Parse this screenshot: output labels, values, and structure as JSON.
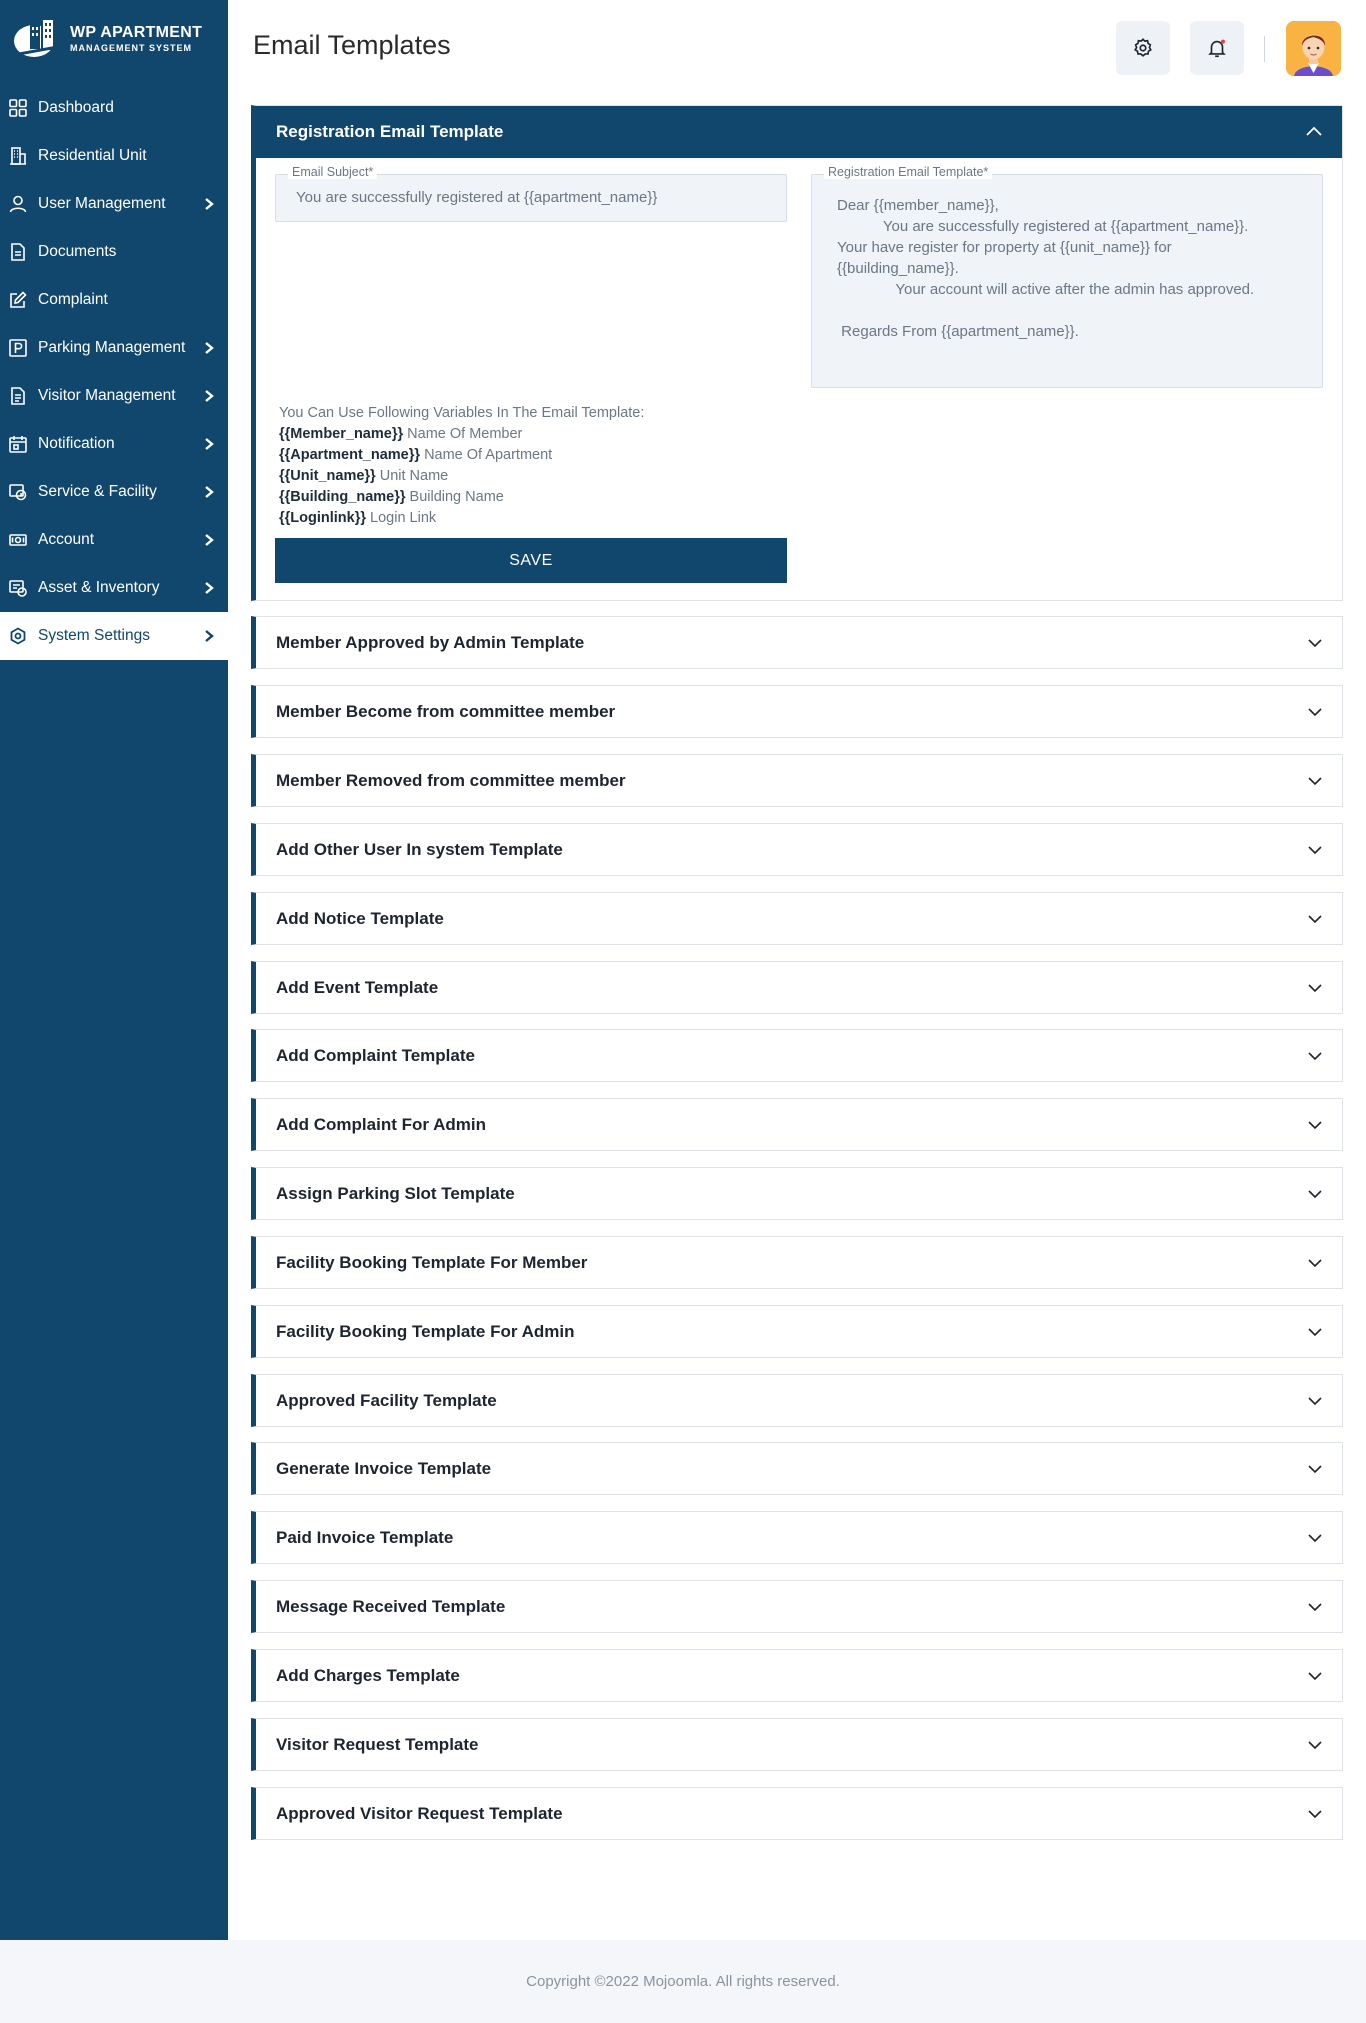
{
  "sidebar": {
    "logo": {
      "title": "WP APARTMENT",
      "subtitle": "MANAGEMENT SYSTEM"
    },
    "items": [
      {
        "label": "Dashboard",
        "icon": "dashboard-grid-icon",
        "has_chevron": false,
        "active": false
      },
      {
        "label": "Residential Unit",
        "icon": "building-icon",
        "has_chevron": false,
        "active": false
      },
      {
        "label": "User Management",
        "icon": "user-icon",
        "has_chevron": true,
        "active": false
      },
      {
        "label": "Documents",
        "icon": "document-icon",
        "has_chevron": false,
        "active": false
      },
      {
        "label": "Complaint",
        "icon": "edit-icon",
        "has_chevron": false,
        "active": false
      },
      {
        "label": "Parking Management",
        "icon": "parking-icon",
        "has_chevron": true,
        "active": false
      },
      {
        "label": "Visitor Management",
        "icon": "clipboard-icon",
        "has_chevron": true,
        "active": false
      },
      {
        "label": "Notification",
        "icon": "calendar-icon",
        "has_chevron": true,
        "active": false
      },
      {
        "label": "Service & Facility",
        "icon": "service-icon",
        "has_chevron": true,
        "active": false
      },
      {
        "label": "Account",
        "icon": "money-icon",
        "has_chevron": true,
        "active": false
      },
      {
        "label": "Asset & Inventory",
        "icon": "inventory-icon",
        "has_chevron": true,
        "active": false
      },
      {
        "label": "System Settings",
        "icon": "settings-icon",
        "has_chevron": true,
        "active": true
      }
    ]
  },
  "header": {
    "title": "Email Templates",
    "settings_icon": "gear-icon",
    "notification_icon": "bell-icon"
  },
  "open_template": {
    "title": "Registration Email Template",
    "subject_label": "Email Subject*",
    "subject_value": "You are successfully registered at {{apartment_name}}",
    "body_label": "Registration Email Template*",
    "body_value": "Dear {{member_name}},\n           You are successfully registered at {{apartment_name}}.\nYour have register for property at {{unit_name}} for\n{{building_name}}.\n              Your account will active after the admin has approved.\n\n Regards From {{apartment_name}}.",
    "variables_heading": "You Can Use Following Variables In The Email Template:",
    "variables": [
      {
        "key": "{{Member_name}}",
        "desc": "Name Of Member"
      },
      {
        "key": "{{Apartment_name}}",
        "desc": "Name Of Apartment"
      },
      {
        "key": "{{Unit_name}}",
        "desc": "Unit Name"
      },
      {
        "key": "{{Building_name}}",
        "desc": "Building Name"
      },
      {
        "key": "{{Loginlink}}",
        "desc": "Login Link"
      }
    ],
    "save_label": "SAVE"
  },
  "templates": [
    "Member Approved by Admin Template",
    "Member Become from committee member",
    "Member Removed from committee member",
    "Add Other User In system Template",
    "Add Notice Template",
    "Add Event Template",
    "Add Complaint Template",
    "Add Complaint For Admin",
    "Assign Parking Slot Template",
    "Facility Booking Template For Member",
    "Facility Booking Template For Admin",
    "Approved Facility Template",
    "Generate Invoice Template",
    "Paid Invoice Template",
    "Message Received Template",
    "Add Charges Template",
    "Visitor Request Template",
    "Approved Visitor Request Template"
  ],
  "footer": {
    "copyright": "Copyright ©2022 Mojoomla. All rights reserved."
  },
  "colors": {
    "primary": "#11466d",
    "background": "#ffffff",
    "field_bg": "#f0f3f7",
    "avatar_bg": "#f9b343"
  }
}
